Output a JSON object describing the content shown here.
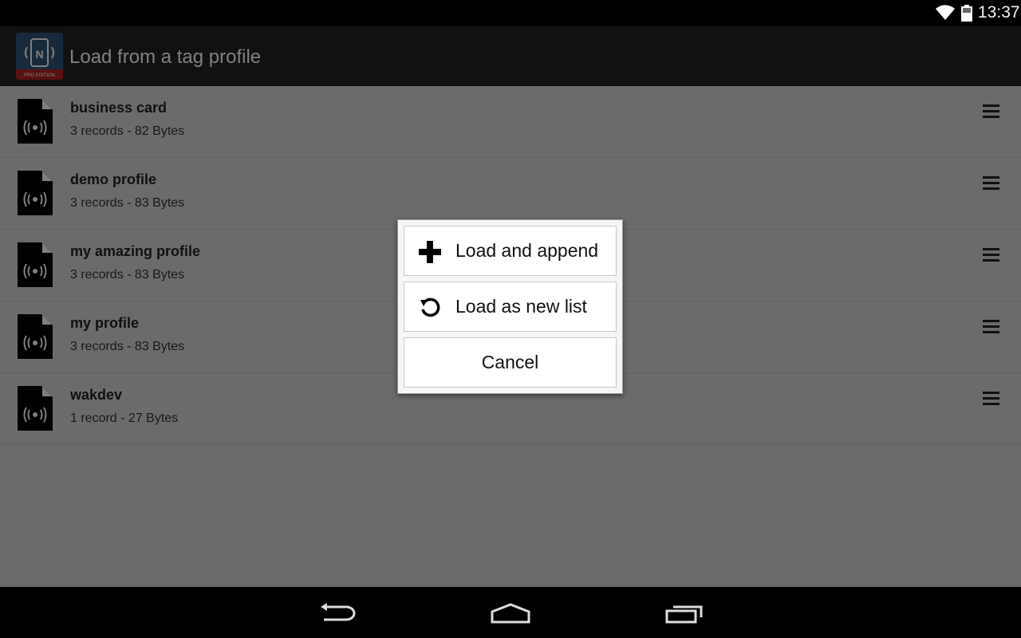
{
  "status_bar": {
    "time": "13:37",
    "wifi_icon": "wifi-icon",
    "battery_icon": "battery-icon"
  },
  "action_bar": {
    "title": "Load from a tag profile",
    "app_icon": "nfc-tools-pro-icon",
    "app_icon_badge": "PRO EDITION"
  },
  "profiles": [
    {
      "name": "business card",
      "meta": "3 records - 82 Bytes"
    },
    {
      "name": "demo profile",
      "meta": "3 records - 83 Bytes"
    },
    {
      "name": "my amazing profile",
      "meta": "3 records - 83 Bytes"
    },
    {
      "name": "my profile",
      "meta": "3 records - 83 Bytes"
    },
    {
      "name": "wakdev",
      "meta": "1 record - 27 Bytes"
    }
  ],
  "dialog": {
    "append_label": "Load and append",
    "new_list_label": "Load as new list",
    "cancel_label": "Cancel"
  },
  "nav_bar": {
    "back_icon": "back-icon",
    "home_icon": "home-icon",
    "recents_icon": "recents-icon"
  }
}
